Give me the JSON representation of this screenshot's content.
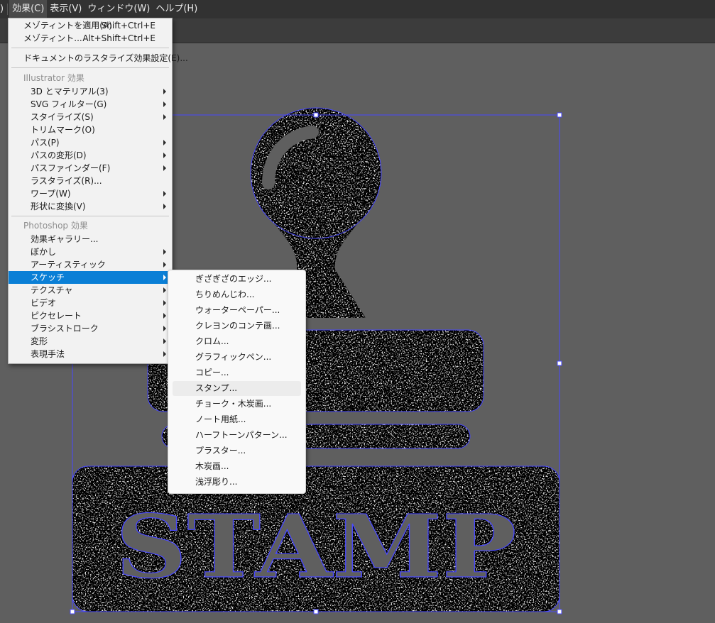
{
  "menubar": {
    "items": [
      ")",
      "効果(C)",
      "表示(V)",
      "ウィンドウ(W)",
      "ヘルプ(H)"
    ],
    "active_index": 1
  },
  "effect_menu": {
    "apply_last": {
      "label": "メゾティントを適用(A)",
      "shortcut": "Shift+Ctrl+E"
    },
    "last_effect": {
      "label": "メゾティント...",
      "shortcut": "Alt+Shift+Ctrl+E"
    },
    "raster_settings": "ドキュメントのラスタライズ効果設定(E)...",
    "illustrator_header": "Illustrator 効果",
    "illustrator_items": [
      {
        "label": "3D とマテリアル(3)",
        "submenu": true
      },
      {
        "label": "SVG フィルター(G)",
        "submenu": true
      },
      {
        "label": "スタイライズ(S)",
        "submenu": true
      },
      {
        "label": "トリムマーク(O)",
        "submenu": false
      },
      {
        "label": "パス(P)",
        "submenu": true
      },
      {
        "label": "パスの変形(D)",
        "submenu": true
      },
      {
        "label": "パスファインダー(F)",
        "submenu": true
      },
      {
        "label": "ラスタライズ(R)...",
        "submenu": false
      },
      {
        "label": "ワープ(W)",
        "submenu": true
      },
      {
        "label": "形状に変換(V)",
        "submenu": true
      }
    ],
    "photoshop_header": "Photoshop 効果",
    "photoshop_items": [
      {
        "label": "効果ギャラリー...",
        "submenu": false
      },
      {
        "label": "ぼかし",
        "submenu": true
      },
      {
        "label": "アーティスティック",
        "submenu": true
      },
      {
        "label": "スケッチ",
        "submenu": true,
        "highlighted": true
      },
      {
        "label": "テクスチャ",
        "submenu": true
      },
      {
        "label": "ビデオ",
        "submenu": true
      },
      {
        "label": "ピクセレート",
        "submenu": true
      },
      {
        "label": "ブラシストローク",
        "submenu": true
      },
      {
        "label": "変形",
        "submenu": true
      },
      {
        "label": "表現手法",
        "submenu": true
      }
    ]
  },
  "sketch_submenu": {
    "items": [
      "ぎざぎざのエッジ...",
      "ちりめんじわ...",
      "ウォーターペーパー...",
      "クレヨンのコンテ画...",
      "クロム...",
      "グラフィックペン...",
      "コピー...",
      "スタンプ...",
      "チョーク・木炭画...",
      "ノート用紙...",
      "ハーフトーンパターン...",
      "プラスター...",
      "木炭画...",
      "浅浮彫り..."
    ],
    "hover_index": 7
  },
  "artwork": {
    "stamp_text": "STAMP"
  },
  "colors": {
    "menu_highlight": "#0a7fd6",
    "selection": "#4a4aff",
    "canvas": "#5f5f5f",
    "menubar": "#323232"
  }
}
